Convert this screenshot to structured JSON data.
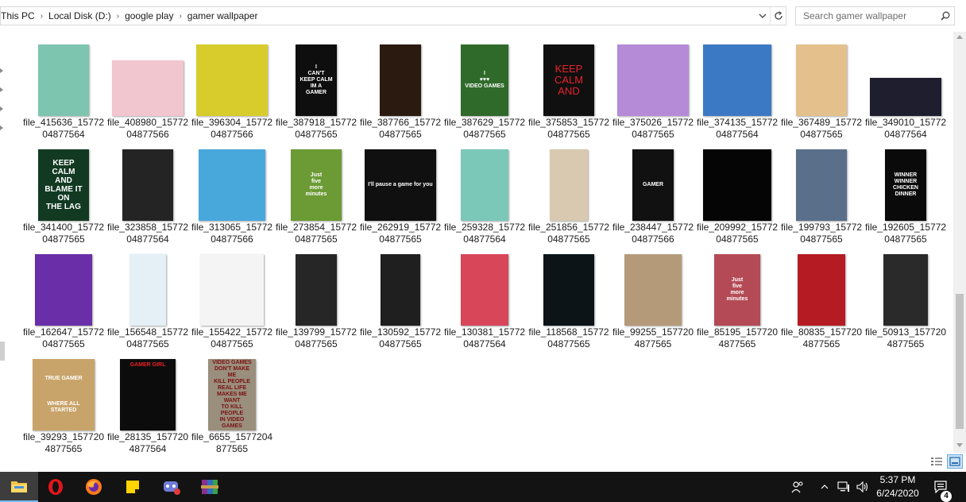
{
  "address_bar": {
    "crumbs": [
      "This PC",
      "Local Disk (D:)",
      "google play",
      "gamer wallpaper"
    ]
  },
  "search": {
    "placeholder": "Search gamer wallpaper"
  },
  "files": [
    {
      "name": "file_415636_1577204877564",
      "line1": "file_415636_15772",
      "line2": "04877564",
      "bg": "#7ec5b0"
    },
    {
      "name": "file_408980_1577204877566",
      "line1": "file_408980_15772",
      "line2": "04877566",
      "bg": "#f2c6cf"
    },
    {
      "name": "file_396304_1577204877566",
      "line1": "file_396304_15772",
      "line2": "04877566",
      "bg": "#d7cc2c"
    },
    {
      "name": "file_387918_1577204877565",
      "line1": "file_387918_15772",
      "line2": "04877565",
      "bg": "#0e0e0e",
      "text": "I\nCAN'T\nKEEP CALM\nIM A\nGAMER"
    },
    {
      "name": "file_387766_1577204877565",
      "line1": "file_387766_15772",
      "line2": "04877565",
      "bg": "#2b1a10"
    },
    {
      "name": "file_387629_1577204877565",
      "line1": "file_387629_15772",
      "line2": "04877565",
      "bg": "#2f6a2a",
      "text": "I\n♥♥♥\nVIDEO GAMES"
    },
    {
      "name": "file_375853_1577204877565",
      "line1": "file_375853_15772",
      "line2": "04877565",
      "bg": "#101010",
      "text": "KEEP\nCALM\nAND"
    },
    {
      "name": "file_375026_1577204877565",
      "line1": "file_375026_15772",
      "line2": "04877565",
      "bg": "#b58bd8"
    },
    {
      "name": "file_374135_1577204877564",
      "line1": "file_374135_15772",
      "line2": "04877564",
      "bg": "#3c79c4"
    },
    {
      "name": "file_367489_1577204877565",
      "line1": "file_367489_15772",
      "line2": "04877565",
      "bg": "#e4c08c"
    },
    {
      "name": "file_349010_1577204877564",
      "line1": "file_349010_15772",
      "line2": "04877564",
      "bg": "#1e1e2e"
    },
    {
      "name": "file_341400_1577204877565",
      "line1": "file_341400_15772",
      "line2": "04877565",
      "bg": "#123a22",
      "text": "KEEP\nCALM\nAND\nBLAME IT\nON\nTHE LAG"
    },
    {
      "name": "file_323858_1577204877564",
      "line1": "file_323858_15772",
      "line2": "04877564",
      "bg": "#242424"
    },
    {
      "name": "file_313065_1577204877566",
      "line1": "file_313065_15772",
      "line2": "04877566",
      "bg": "#48a8dc"
    },
    {
      "name": "file_273854_1577204877565",
      "line1": "file_273854_15772",
      "line2": "04877565",
      "bg": "#6c9b35",
      "text": "Just\nfive\nmore\nminutes"
    },
    {
      "name": "file_262919_1577204877565",
      "line1": "file_262919_15772",
      "line2": "04877565",
      "bg": "#101010",
      "text": "I'll pause a game for you"
    },
    {
      "name": "file_259328_1577204877564",
      "line1": "file_259328_15772",
      "line2": "04877564",
      "bg": "#7bc7b8"
    },
    {
      "name": "file_251856_1577204877565",
      "line1": "file_251856_15772",
      "line2": "04877565",
      "bg": "#d8c9b0"
    },
    {
      "name": "file_238447_1577204877566",
      "line1": "file_238447_15772",
      "line2": "04877566",
      "bg": "#111111",
      "text": "GAMER"
    },
    {
      "name": "file_209992_1577204877565",
      "line1": "file_209992_15772",
      "line2": "04877565",
      "bg": "#050505"
    },
    {
      "name": "file_199793_1577204877565",
      "line1": "file_199793_15772",
      "line2": "04877565",
      "bg": "#5a6f8a"
    },
    {
      "name": "file_192605_1577204877565",
      "line1": "file_192605_15772",
      "line2": "04877565",
      "bg": "#0a0a0a",
      "text": "WINNER WINNER\nCHICKEN DINNER"
    },
    {
      "name": "file_162647_1577204877565",
      "line1": "file_162647_15772",
      "line2": "04877565",
      "bg": "#6a2fa8"
    },
    {
      "name": "file_156548_1577204877565",
      "line1": "file_156548_15772",
      "line2": "04877565",
      "bg": "#e4f0f5"
    },
    {
      "name": "file_155422_1577204877565",
      "line1": "file_155422_15772",
      "line2": "04877565",
      "bg": "#f4f4f4"
    },
    {
      "name": "file_139799_1577204877565",
      "line1": "file_139799_15772",
      "line2": "04877565",
      "bg": "#262626"
    },
    {
      "name": "file_130592_1577204877565",
      "line1": "file_130592_15772",
      "line2": "04877565",
      "bg": "#1f1f1f"
    },
    {
      "name": "file_130381_1577204877564",
      "line1": "file_130381_15772",
      "line2": "04877564",
      "bg": "#d8465a"
    },
    {
      "name": "file_118568_1577204877565",
      "line1": "file_118568_15772",
      "line2": "04877565",
      "bg": "#0c1418"
    },
    {
      "name": "file_99255_1577204877565",
      "line1": "file_99255_157720",
      "line2": "4877565",
      "bg": "#b59a7a"
    },
    {
      "name": "file_85195_1577204877565",
      "line1": "file_85195_157720",
      "line2": "4877565",
      "bg": "#b44a55",
      "text": "Just\nfive\nmore\nminutes"
    },
    {
      "name": "file_80835_1577204877565",
      "line1": "file_80835_157720",
      "line2": "4877565",
      "bg": "#b51b22"
    },
    {
      "name": "file_50913_1577204877565",
      "line1": "file_50913_157720",
      "line2": "4877565",
      "bg": "#2a2a2a"
    },
    {
      "name": "file_39293_1577204877565",
      "line1": "file_39293_157720",
      "line2": "4877565",
      "bg": "#c9a46a",
      "text": "TRUE GAMER\n\n\n\nWHERE ALL\nSTARTED"
    },
    {
      "name": "file_28135_1577204877564",
      "line1": "file_28135_157720",
      "line2": "4877564",
      "bg": "#0c0c0c",
      "text": "GAMER GIRL"
    },
    {
      "name": "file_6655_1577204877565",
      "line1": "file_6655_1577204",
      "line2": "877565",
      "bg": "#9a8e7c",
      "text": "VIDEO GAMES\nDON'T MAKE ME\nKILL PEOPLE\nREAL LIFE\nMAKES ME WANT\nTO KILL PEOPLE\nIN VIDEO\nGAMES"
    }
  ],
  "taskbar": {
    "time": "5:37 PM",
    "date": "6/24/2020",
    "notification_count": "4"
  }
}
